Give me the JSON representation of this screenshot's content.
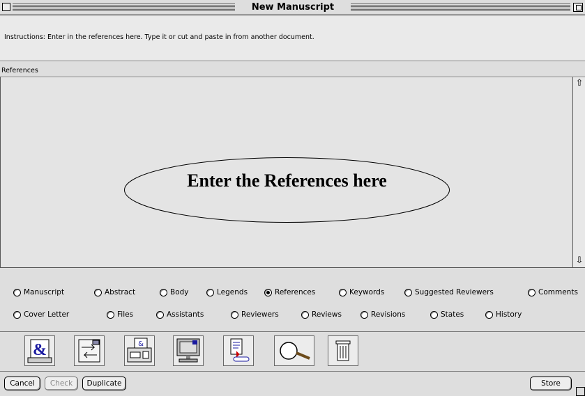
{
  "window": {
    "title": "New Manuscript"
  },
  "instructions": "Instructions: Enter in the references here. Type it or cut and paste in from another document.",
  "section_label": "References",
  "placeholder_callout": "Enter the References here",
  "radios": {
    "row1": [
      {
        "label": "Manuscript",
        "selected": false
      },
      {
        "label": "Abstract",
        "selected": false
      },
      {
        "label": "Body",
        "selected": false
      },
      {
        "label": "Legends",
        "selected": false
      },
      {
        "label": "References",
        "selected": true
      },
      {
        "label": "Keywords",
        "selected": false
      },
      {
        "label": "Suggested Reviewers",
        "selected": false
      },
      {
        "label": "Comments",
        "selected": false
      }
    ],
    "row2": [
      {
        "label": "Cover Letter",
        "selected": false
      },
      {
        "label": "Files",
        "selected": false
      },
      {
        "label": "Assistants",
        "selected": false
      },
      {
        "label": "Reviewers",
        "selected": false
      },
      {
        "label": "Reviews",
        "selected": false
      },
      {
        "label": "Revisions",
        "selected": false
      },
      {
        "label": "States",
        "selected": false
      },
      {
        "label": "History",
        "selected": false
      }
    ]
  },
  "toolbar": {
    "icons": [
      "letter-ampersand-icon",
      "transfer-arrows-icon",
      "fax-machine-icon",
      "monitor-icon",
      "document-import-icon",
      "magnifier-icon",
      "trash-icon"
    ]
  },
  "buttons": {
    "cancel": "Cancel",
    "check": "Check",
    "duplicate": "Duplicate",
    "store": "Store"
  },
  "colors": {
    "radio_selected": "#000000",
    "toolbar_blue": "#1a1aa0"
  }
}
